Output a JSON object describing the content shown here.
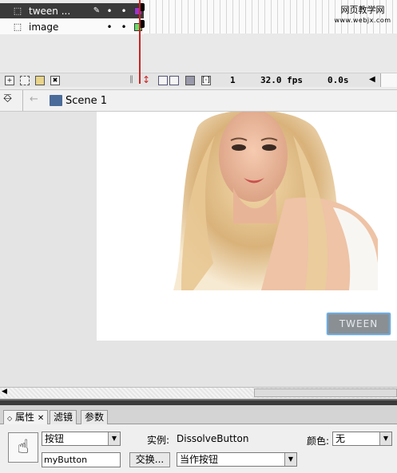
{
  "timeline": {
    "layers": [
      {
        "name": "tween ...",
        "color": "#9933cc"
      },
      {
        "name": "image",
        "color": "#66dd66"
      }
    ],
    "watermark_line1": "网页教学网",
    "watermark_line2": "www.webjx.com",
    "current_frame": "1",
    "fps": "32.0 fps",
    "time": "0.0s"
  },
  "edit_bar": {
    "scene": "Scene 1"
  },
  "stage": {
    "button_label": "TWEEN"
  },
  "panel": {
    "tabs": [
      {
        "label": "属性",
        "active": true
      },
      {
        "label": "滤镜",
        "active": false
      },
      {
        "label": "参数",
        "active": false
      }
    ],
    "symbol_type": "按钮",
    "instance_label": "实例:",
    "instance_name": "DissolveButton",
    "color_label": "颜色:",
    "color_value": "无",
    "instance_input": "myButton",
    "swap_button": "交换...",
    "track_as": "当作按钮"
  }
}
